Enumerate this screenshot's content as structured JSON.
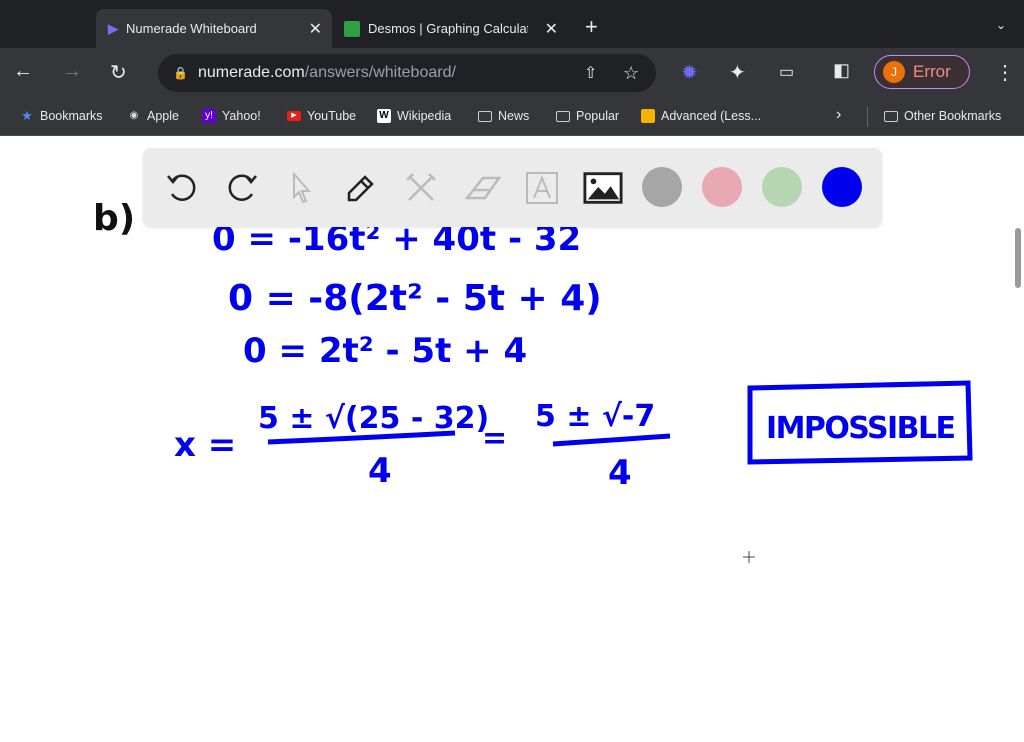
{
  "browser": {
    "tabs": [
      {
        "title": "Numerade Whiteboard",
        "active": true
      },
      {
        "title": "Desmos | Graphing Calculato",
        "active": false
      }
    ],
    "url_host": "numerade.com",
    "url_path": "/answers/whiteboard/",
    "profile_initial": "J",
    "profile_status": "Error",
    "bookmarks": [
      "Bookmarks",
      "Apple",
      "Yahoo!",
      "YouTube",
      "Wikipedia",
      "News",
      "Popular",
      "Advanced (Less..."
    ],
    "other_bookmarks": "Other Bookmarks"
  },
  "whiteboard": {
    "tools": [
      "undo-icon",
      "redo-icon",
      "pointer-icon",
      "pen-icon",
      "tools-icon",
      "eraser-icon",
      "text-icon",
      "image-icon"
    ],
    "colors": [
      "#a6a6a6",
      "#e8a9b4",
      "#b5d6b1",
      "#0000ee"
    ],
    "ink_color": "#0000ee",
    "handwriting": {
      "part": "b)",
      "line1": "0 = -16t² + 40t - 32",
      "line2": "0 = -8(2t² - 5t + 4)",
      "line3": "0 = 2t² - 5t + 4",
      "x_eq": "x =",
      "num1": "5 ± √(25 - 32)",
      "den1": "4",
      "eq2": "=",
      "num2": "5 ± √-7",
      "den2": "4",
      "answer": "IMPOSSIBLE"
    }
  }
}
